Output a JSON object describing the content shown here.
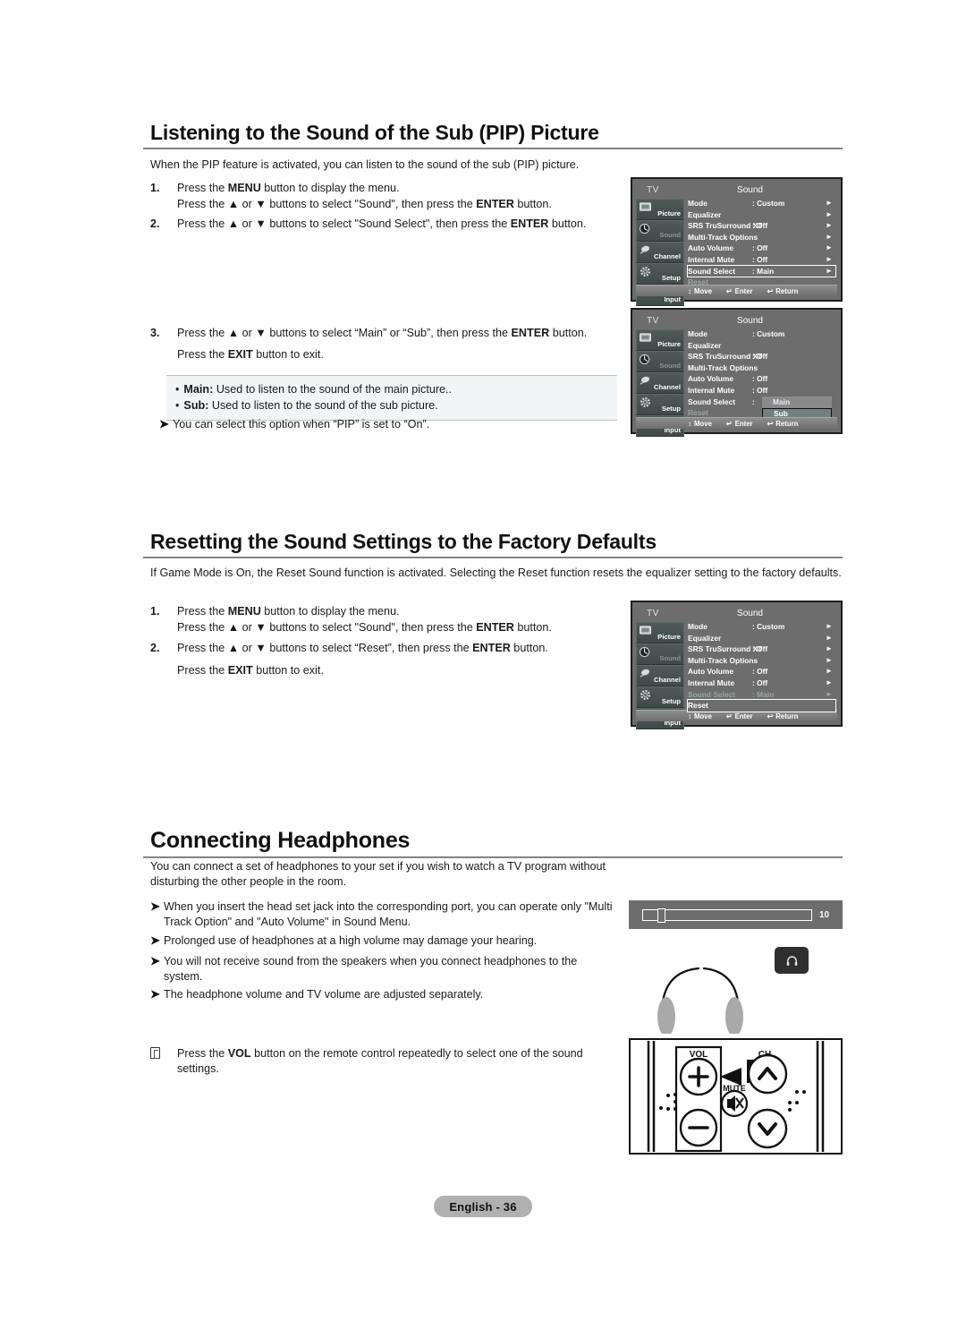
{
  "sections": [
    {
      "id": "pip-sound",
      "heading": "Listening to the Sound of the Sub (PIP) Picture",
      "intro": "When the PIP feature is activated, you can listen to the sound of the sub (PIP) picture.",
      "steps": [
        {
          "num": "1.",
          "lines": [
            "Press the MENU button to display the menu.",
            "Press the ▲ or ▼ buttons to select \"Sound\", then press the ENTER button."
          ]
        },
        {
          "num": "2.",
          "lines": [
            "Press the ▲ or ▼ buttons to select \"Sound Select\", then press the ENTER button."
          ]
        },
        {
          "num": "3.",
          "lines": [
            "Press the ▲ or ▼ buttons to select “Main” or “Sub”, then press the ENTER button.",
            "Press the EXIT button to exit."
          ]
        }
      ],
      "infobox": [
        {
          "term": "Main:",
          "desc": "Used to listen to the sound of the main picture.."
        },
        {
          "term": "Sub:",
          "desc": "Used to listen to the sound of the sub picture."
        }
      ],
      "note": "You can select this option when “PIP” is set to “On”."
    },
    {
      "id": "reset-sound",
      "heading": "Resetting the Sound Settings to the Factory Defaults",
      "intro": "If Game Mode is On, the Reset Sound function is activated. Selecting the Reset function resets the equalizer setting to the factory defaults.",
      "steps": [
        {
          "num": "1.",
          "lines": [
            "Press the MENU button to display the menu.",
            "Press the ▲ or ▼ buttons to select \"Sound\", then press the ENTER button."
          ]
        },
        {
          "num": "2.",
          "lines": [
            "Press the ▲ or ▼ buttons to select “Reset”, then press the ENTER button.",
            "Press the EXIT button to exit."
          ]
        }
      ]
    },
    {
      "id": "headphones",
      "heading": "Connecting Headphones",
      "intro": "You can connect a set of headphones to your set if you wish to watch a TV program without disturbing the other people in the room.",
      "notes": [
        "When you insert the head set jack into the corresponding port, you can operate only \"Multi Track Option\" and \"Auto Volume\" in Sound Menu.",
        "Prolonged use of headphones at a high volume may damage your hearing.",
        "You will not receive sound from the speakers when you connect headphones to the system.",
        "The headphone volume and TV volume are adjusted separately."
      ],
      "booknote": "Press the VOL button on the remote control repeatedly to select one of the sound settings."
    }
  ],
  "osd_common": {
    "tv_label": "TV",
    "title": "Sound",
    "sidebar": [
      {
        "label": "Picture",
        "icon": "picture-icon",
        "dim": false
      },
      {
        "label": "Sound",
        "icon": "sound-icon",
        "dim": true
      },
      {
        "label": "Channel",
        "icon": "channel-icon",
        "dim": false
      },
      {
        "label": "Setup",
        "icon": "setup-icon",
        "dim": false
      },
      {
        "label": "Input",
        "icon": "input-icon",
        "dim": false
      }
    ],
    "footbar": [
      {
        "icon": "↕",
        "label": "Move"
      },
      {
        "icon": "↵",
        "label": "Enter"
      },
      {
        "icon": "↩",
        "label": "Return"
      }
    ]
  },
  "osd1": {
    "rows": [
      {
        "label": "Mode",
        "value": ": Custom",
        "arrow": "►",
        "dim": false,
        "sel": false
      },
      {
        "label": "Equalizer",
        "value": "",
        "arrow": "►",
        "dim": false,
        "sel": false
      },
      {
        "label": "SRS TruSurround XT",
        "value": ": Off",
        "arrow": "►",
        "dim": false,
        "sel": false
      },
      {
        "label": "Multi-Track Options",
        "value": "",
        "arrow": "►",
        "dim": false,
        "sel": false
      },
      {
        "label": "Auto Volume",
        "value": ": Off",
        "arrow": "►",
        "dim": false,
        "sel": false
      },
      {
        "label": "Internal Mute",
        "value": ": Off",
        "arrow": "►",
        "dim": false,
        "sel": false
      },
      {
        "label": "Sound Select",
        "value": ": Main",
        "arrow": "►",
        "dim": false,
        "sel": true
      },
      {
        "label": "Reset",
        "value": "",
        "arrow": "",
        "dim": true,
        "sel": false
      }
    ]
  },
  "osd2": {
    "rows": [
      {
        "label": "Mode",
        "value": ": Custom",
        "arrow": "",
        "dim": false,
        "sel": false
      },
      {
        "label": "Equalizer",
        "value": "",
        "arrow": "",
        "dim": false,
        "sel": false
      },
      {
        "label": "SRS TruSurround XT",
        "value": ": Off",
        "arrow": "",
        "dim": false,
        "sel": false
      },
      {
        "label": "Multi-Track Options",
        "value": "",
        "arrow": "",
        "dim": false,
        "sel": false
      },
      {
        "label": "Auto Volume",
        "value": ": Off",
        "arrow": "",
        "dim": false,
        "sel": false
      },
      {
        "label": "Internal Mute",
        "value": ": Off",
        "arrow": "",
        "dim": false,
        "sel": false
      },
      {
        "label": "Sound Select",
        "value": ":",
        "arrow": "",
        "dim": false,
        "sel": false
      },
      {
        "label": "Reset",
        "value": "",
        "arrow": "",
        "dim": true,
        "sel": false
      }
    ],
    "dropdown": {
      "options": [
        "Main",
        "Sub"
      ],
      "active": "Sub"
    }
  },
  "osd3": {
    "rows": [
      {
        "label": "Mode",
        "value": ": Custom",
        "arrow": "►",
        "dim": false,
        "sel": false
      },
      {
        "label": "Equalizer",
        "value": "",
        "arrow": "►",
        "dim": false,
        "sel": false
      },
      {
        "label": "SRS TruSurround XT",
        "value": ": Off",
        "arrow": "►",
        "dim": false,
        "sel": false
      },
      {
        "label": "Multi-Track Options",
        "value": "",
        "arrow": "►",
        "dim": false,
        "sel": false
      },
      {
        "label": "Auto Volume",
        "value": ": Off",
        "arrow": "►",
        "dim": false,
        "sel": false
      },
      {
        "label": "Internal Mute",
        "value": ": Off",
        "arrow": "►",
        "dim": false,
        "sel": false
      },
      {
        "label": "Sound Select",
        "value": ": Main",
        "arrow": "►",
        "dim": true,
        "sel": false
      },
      {
        "label": "Reset",
        "value": "",
        "arrow": "",
        "dim": false,
        "sel": true
      }
    ]
  },
  "volume_display": {
    "level": "10"
  },
  "remote": {
    "vol_label": "VOL",
    "ch_label": "CH",
    "mute_label": "MUTE",
    "vol_up": "+",
    "vol_down": "−"
  },
  "footer": {
    "page_label": "English - 36"
  },
  "colors": {
    "osd_bg": "#6d6d6d",
    "osd_border": "#1d1d1d",
    "infobox_bg": "#f2f5f6",
    "rule": "#9a9a9a",
    "footer_pill": "#b0b0b0"
  }
}
